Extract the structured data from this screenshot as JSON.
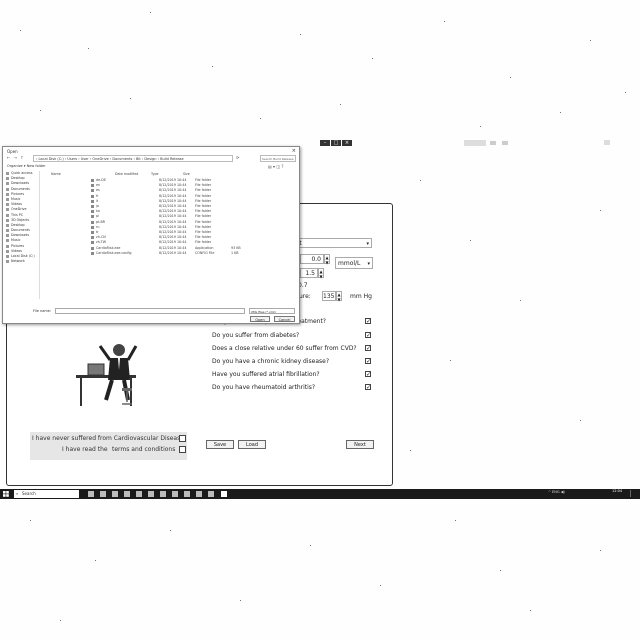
{
  "app": {
    "window_title": "",
    "select_value": "...it",
    "glucose_value": "0.0",
    "glucose_unit": "mmol/L",
    "hdl_value": "1.5",
    "ratio_value": "0.7",
    "bp_label": "essure:",
    "bp_value": "135",
    "bp_unit": "mm Hg",
    "questions": [
      {
        "text": "Are you on blood pressure treatment?",
        "checked": true
      },
      {
        "text": "Do you suffer from diabetes?",
        "checked": true
      },
      {
        "text": "Does a close relative under 60 suffer from CVD?",
        "checked": true
      },
      {
        "text": "Do you have a chronic kidney disease?",
        "checked": true
      },
      {
        "text": "Have you suffered atrial fibrillation?",
        "checked": true
      },
      {
        "text": "Do you have rheumatoid arthritis?",
        "checked": true
      }
    ],
    "save_label": "Save",
    "load_label": "Load",
    "next_label": "Next",
    "consent": {
      "never_cvd": "I have never suffered from Cardiovascular Disease",
      "terms_prefix": "I have read the",
      "terms_link": "terms and conditions"
    }
  },
  "dialog": {
    "title": "Open",
    "address": "› Local Disk (C:) › Users › User › OneDrive › Documents › Bit › Design › Build Release",
    "search_placeholder": "Search Build Release",
    "organize_label": "Organize ▾   New folder",
    "nav_items": [
      "Quick access",
      "Desktop",
      "Downloads",
      "Documents",
      "Pictures",
      "Music",
      "Videos",
      "OneDrive",
      "This PC",
      "3D Objects",
      "Desktop",
      "Documents",
      "Downloads",
      "Music",
      "Pictures",
      "Videos",
      "Local Disk (C:)",
      "Network"
    ],
    "columns": {
      "name": "Name",
      "date": "Date modified",
      "type": "Type",
      "size": "Size"
    },
    "files": [
      {
        "name": "de-DE",
        "date": "8/12/2019 10:44",
        "type": "File folder",
        "size": ""
      },
      {
        "name": "en",
        "date": "8/12/2019 10:44",
        "type": "File folder",
        "size": ""
      },
      {
        "name": "es",
        "date": "8/12/2019 10:44",
        "type": "File folder",
        "size": ""
      },
      {
        "name": "fr",
        "date": "8/12/2019 10:44",
        "type": "File folder",
        "size": ""
      },
      {
        "name": "it",
        "date": "8/12/2019 10:44",
        "type": "File folder",
        "size": ""
      },
      {
        "name": "ja",
        "date": "8/12/2019 10:44",
        "type": "File folder",
        "size": ""
      },
      {
        "name": "ko",
        "date": "8/12/2019 10:44",
        "type": "File folder",
        "size": ""
      },
      {
        "name": "pl",
        "date": "8/12/2019 10:44",
        "type": "File folder",
        "size": ""
      },
      {
        "name": "pt-BR",
        "date": "8/12/2019 10:44",
        "type": "File folder",
        "size": ""
      },
      {
        "name": "ru",
        "date": "8/12/2019 10:44",
        "type": "File folder",
        "size": ""
      },
      {
        "name": "tr",
        "date": "8/12/2019 10:44",
        "type": "File folder",
        "size": ""
      },
      {
        "name": "zh-CN",
        "date": "8/12/2019 10:44",
        "type": "File folder",
        "size": ""
      },
      {
        "name": "zh-TW",
        "date": "8/12/2019 10:44",
        "type": "File folder",
        "size": ""
      },
      {
        "name": "CardioRisk.exe",
        "date": "8/12/2019 10:44",
        "type": "Application",
        "size": "93 KB"
      },
      {
        "name": "CardioRisk.exe.config",
        "date": "8/12/2019 10:44",
        "type": "CONFIG File",
        "size": "1 KB"
      }
    ],
    "filename_label": "File name:",
    "filetype_value": "XML files (*.xml)",
    "open_label": "Open",
    "cancel_label": "Cancel"
  },
  "taskbar": {
    "search_text": "Search",
    "tray_text": "^  ENG  ◀)",
    "time": "12:04",
    "date": "8/12/2019"
  }
}
